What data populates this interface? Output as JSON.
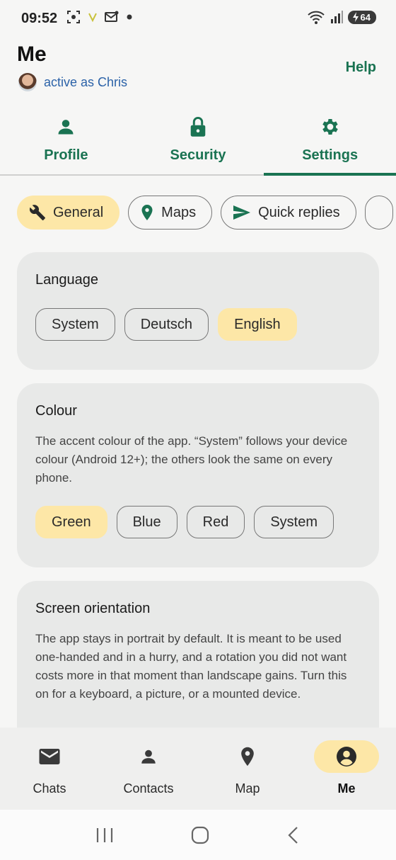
{
  "status_bar": {
    "time": "09:52",
    "battery": "64"
  },
  "header": {
    "title": "Me",
    "active_text": "active as Chris",
    "help_label": "Help"
  },
  "tabs": [
    {
      "label": "Profile",
      "icon": "person-icon"
    },
    {
      "label": "Security",
      "icon": "lock-icon"
    },
    {
      "label": "Settings",
      "icon": "gear-icon",
      "active": true
    }
  ],
  "category_chips": [
    {
      "label": "General",
      "icon": "wrench-icon",
      "selected": true
    },
    {
      "label": "Maps",
      "icon": "map-pin-icon"
    },
    {
      "label": "Quick replies",
      "icon": "send-icon"
    }
  ],
  "language": {
    "title": "Language",
    "options": [
      "System",
      "Deutsch",
      "English"
    ],
    "selected": "English"
  },
  "colour": {
    "title": "Colour",
    "description": "The accent colour of the app. “System” follows your device colour (Android 12+); the others look the same on every phone.",
    "options": [
      "Green",
      "Blue",
      "Red",
      "System"
    ],
    "selected": "Green"
  },
  "orientation": {
    "title": "Screen orientation",
    "description": "The app stays in portrait by default. It is meant to be used one-handed and in a hurry, and a rotation you did not want costs more in that moment than landscape gains. Turn this on for a keyboard, a picture, or a mounted device."
  },
  "bottom_nav": [
    {
      "label": "Chats",
      "icon": "mail-icon"
    },
    {
      "label": "Contacts",
      "icon": "person-icon"
    },
    {
      "label": "Map",
      "icon": "map-pin-icon"
    },
    {
      "label": "Me",
      "icon": "account-circle-icon",
      "active": true
    }
  ],
  "colors": {
    "accent": "#1a7352",
    "selected": "#fde7a7",
    "link": "#2b62a8"
  }
}
